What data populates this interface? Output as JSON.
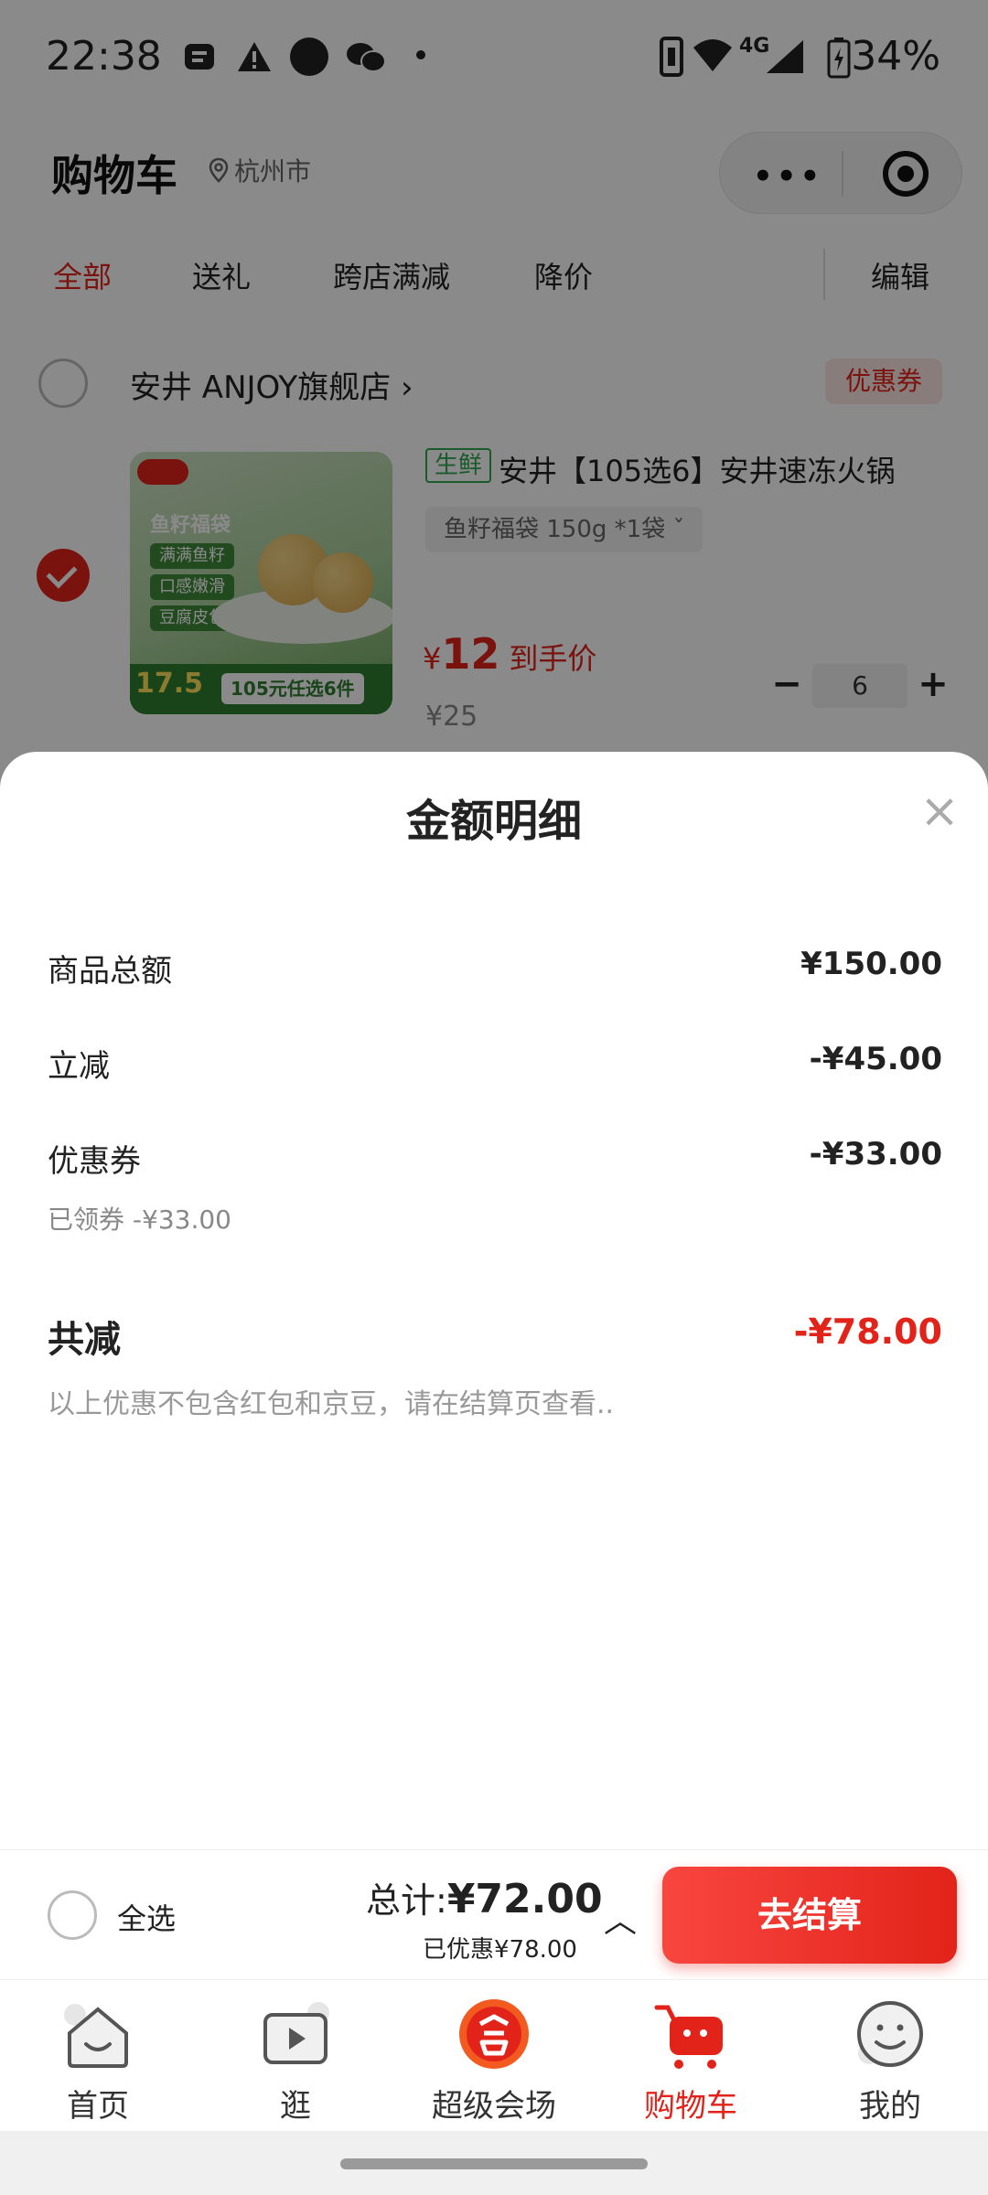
{
  "status_bar": {
    "time": "22:38",
    "network": "4G",
    "battery": "34%"
  },
  "header": {
    "title": "购物车",
    "location": "杭州市"
  },
  "tabs": [
    {
      "label": "全部",
      "active": true
    },
    {
      "label": "送礼",
      "active": false
    },
    {
      "label": "跨店满减",
      "active": false
    },
    {
      "label": "降价",
      "active": false
    }
  ],
  "edit_label": "编辑",
  "shop": {
    "name": "安井 ANJOY旗舰店",
    "coupon_label": "优惠券"
  },
  "item": {
    "tag": "生鲜",
    "name": "安井【105选6】安井速冻火锅",
    "spec": "鱼籽福袋 150g *1袋",
    "price_currency": "¥",
    "price": "12",
    "price_label": "到手价",
    "original_price": "¥25",
    "quantity": "6",
    "image_texts": {
      "title": "鱼籽福袋",
      "chips": [
        "满满鱼籽",
        "口感嫩滑",
        "豆腐皮包裹"
      ],
      "price": "17.5",
      "deal": "105元任选6件"
    }
  },
  "sheet": {
    "title": "金额明细",
    "rows": [
      {
        "label": "商品总额",
        "value": "¥150.00"
      },
      {
        "label": "立减",
        "value": "-¥45.00"
      },
      {
        "label": "优惠券",
        "value": "-¥33.00",
        "sub": "已领券 -¥33.00"
      }
    ],
    "total_label": "共减",
    "total_value": "-¥78.00",
    "note": "以上优惠不包含红包和京豆，请在结算页查看.."
  },
  "checkout": {
    "select_all": "全选",
    "total_prefix": "总计:",
    "total_value": "¥72.00",
    "discount": "已优惠¥78.00",
    "button": "去结算"
  },
  "tabbar": [
    {
      "label": "首页",
      "icon": "home-icon",
      "active": false
    },
    {
      "label": "逛",
      "icon": "video-icon",
      "active": false
    },
    {
      "label": "超级会场",
      "icon": "super-venue-icon",
      "active": false
    },
    {
      "label": "购物车",
      "icon": "cart-icon",
      "active": true
    },
    {
      "label": "我的",
      "icon": "profile-icon",
      "active": false
    }
  ],
  "colors": {
    "accent": "#e2231a",
    "fresh_tag": "#2fa84f"
  }
}
